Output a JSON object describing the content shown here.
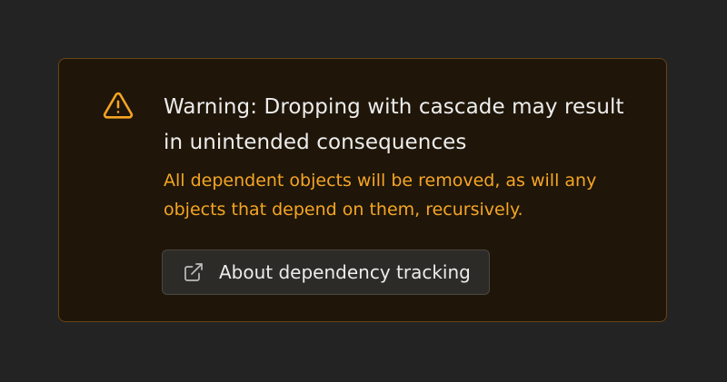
{
  "alert": {
    "icon": "warning-triangle-icon",
    "title": "Warning: Dropping with cascade may result in unintended consequences",
    "description": "All dependent objects will be removed, as will any objects that depend on them, recursively.",
    "link_button": {
      "icon": "external-link-icon",
      "label": "About dependency tracking"
    }
  },
  "colors": {
    "page_background": "#232323",
    "alert_background": "#1f1609",
    "alert_border": "#6b4314",
    "warning_accent": "#f5a524",
    "title_text": "#ededed",
    "button_background": "#2d2b27"
  }
}
